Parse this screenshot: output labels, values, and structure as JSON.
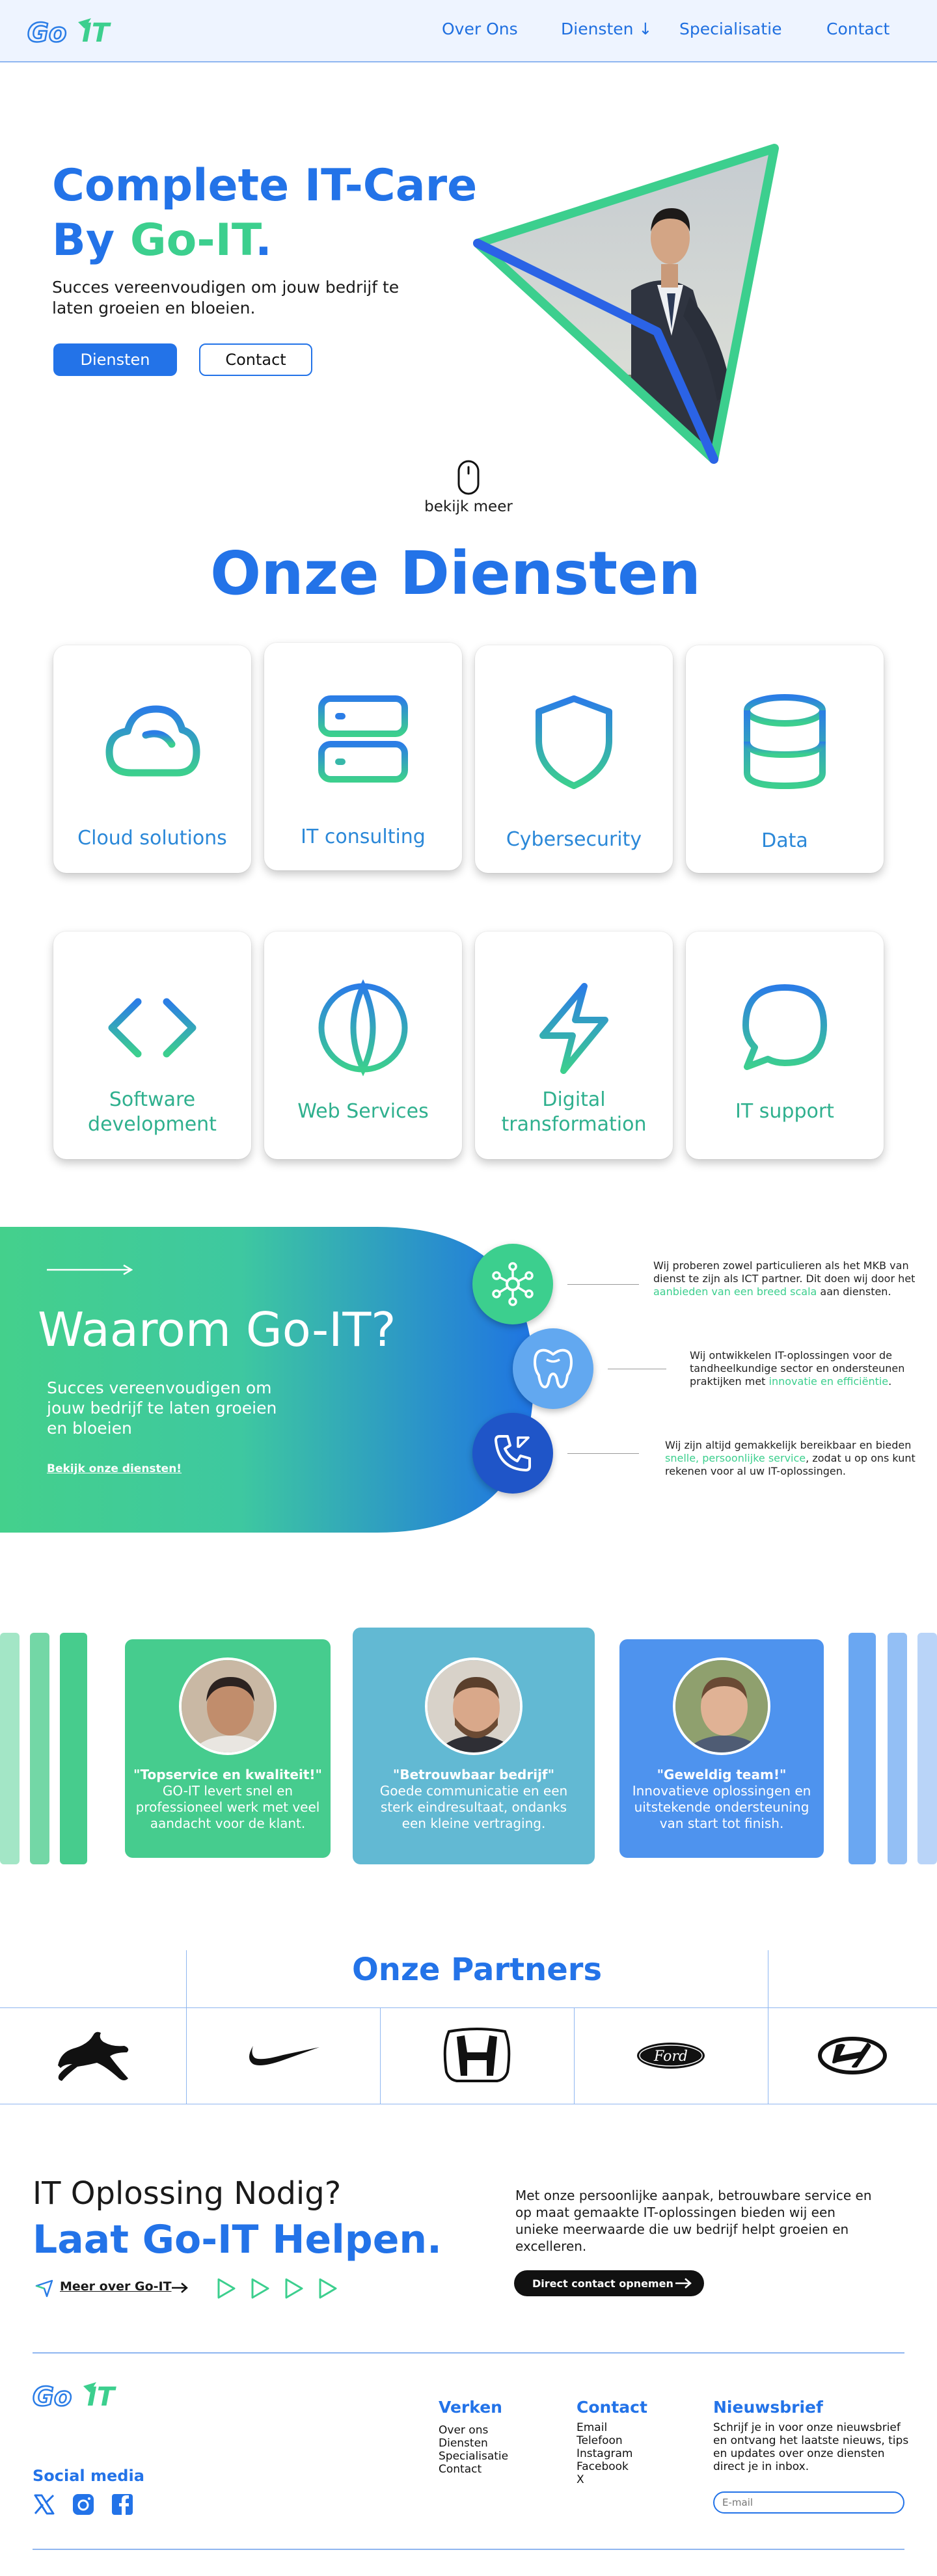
{
  "brand": {
    "logo_text": "GoIT"
  },
  "nav": {
    "items": [
      "Over Ons",
      "Diensten ↓",
      "Specialisatie",
      "Contact"
    ]
  },
  "hero": {
    "title_line1": "Complete IT-Care",
    "title_by": "By ",
    "title_brand": "Go-IT",
    "title_dot": ".",
    "subtitle_line1": "Succes vereenvoudigen om jouw bedrijf te",
    "subtitle_line2": "laten groeien en bloeien.",
    "btn_diensten": "Diensten",
    "btn_contact": "Contact"
  },
  "scroll_hint": "bekijk meer",
  "services": {
    "heading": "Onze Diensten",
    "items": [
      {
        "label": "Cloud solutions",
        "icon": "cloud-icon"
      },
      {
        "label": "IT consulting",
        "icon": "server-icon"
      },
      {
        "label": "Cybersecurity",
        "icon": "shield-icon"
      },
      {
        "label": "Data",
        "icon": "database-icon"
      },
      {
        "label_line1": "Software",
        "label_line2": "development",
        "icon": "code-icon"
      },
      {
        "label": "Web Services",
        "icon": "globe-icon"
      },
      {
        "label_line1": "Digital",
        "label_line2": "transformation",
        "icon": "lightning-icon"
      },
      {
        "label": "IT support",
        "icon": "chat-icon"
      }
    ]
  },
  "why": {
    "title": "Waarom Go-IT?",
    "text_line1": "Succes vereenvoudigen om",
    "text_line2": "jouw bedrijf te laten groeien",
    "text_line3": "en bloeien",
    "link": "Bekijk onze diensten!",
    "points": [
      {
        "icon": "network-icon",
        "l1": "Wij proberen zowel particulieren als het MKB van",
        "l2": "dienst te zijn als ICT partner. Dit doen wij door het",
        "l3_hl": "aanbieden van een breed scala",
        "l3_rest": " aan diensten."
      },
      {
        "icon": "tooth-icon",
        "l1": "Wij ontwikkelen IT-oplossingen voor de",
        "l2": "tandheelkundige sector en ondersteunen",
        "l3_pre": "praktijken met ",
        "l3_hl": "innovatie en efficiëntie",
        "l3_rest": "."
      },
      {
        "icon": "phone-icon",
        "l1": "Wij zijn altijd gemakkelijk bereikbaar en bieden",
        "l2_hl": "snelle, persoonlijke service",
        "l2_rest": ", zodat u op ons kunt",
        "l3": "rekenen voor al uw IT-oplossingen."
      }
    ]
  },
  "testimonials": [
    {
      "quote": "\"Topservice en kwaliteit!\"",
      "l1": "GO-IT levert snel en",
      "l2": "professioneel werk met veel",
      "l3": "aandacht voor de klant."
    },
    {
      "quote": "\"Betrouwbaar bedrijf\"",
      "l1": "Goede communicatie en een",
      "l2": "sterk eindresultaat, ondanks",
      "l3": "een kleine vertraging."
    },
    {
      "quote": "\"Geweldig team!\"",
      "l1": "Innovatieve oplossingen en",
      "l2": "uitstekende ondersteuning",
      "l3": "van start tot finish."
    }
  ],
  "partners": {
    "heading": "Onze Partners",
    "logos": [
      "puma-logo",
      "nike-logo",
      "honda-logo",
      "ford-logo",
      "hyundai-logo"
    ],
    "ford_text": "Ford"
  },
  "cta": {
    "line1": "IT Oplossing Nodig?",
    "line2": "Laat Go-IT Helpen.",
    "link": "Meer over Go-IT",
    "text_l1": "Met onze persoonlijke aanpak, betrouwbare service en",
    "text_l2": "op maat gemaakte IT-oplossingen bieden wij een",
    "text_l3": "unieke meerwaarde die uw bedrijf helpt groeien en",
    "text_l4": "excelleren.",
    "button": "Direct contact opnemen"
  },
  "footer": {
    "social_heading": "Social media",
    "verken": {
      "heading": "Verken",
      "items": [
        "Over ons",
        "Diensten",
        "Specialisatie",
        "Contact"
      ]
    },
    "contact": {
      "heading": "Contact",
      "items": [
        "Email",
        "Telefoon",
        "Instagram",
        "Facebook",
        "X"
      ]
    },
    "newsletter": {
      "heading": "Nieuwsbrief",
      "l1": "Schrijf je in voor onze nieuwsbrief",
      "l2": "en ontvang het laatste nieuws, tips",
      "l3": "en updates over onze diensten",
      "l4": "direct je in inbox.",
      "placeholder": "E-mail"
    }
  },
  "colors": {
    "blue": "#2373e8",
    "green": "#3ccf8e",
    "teal": "#62b9d3"
  }
}
